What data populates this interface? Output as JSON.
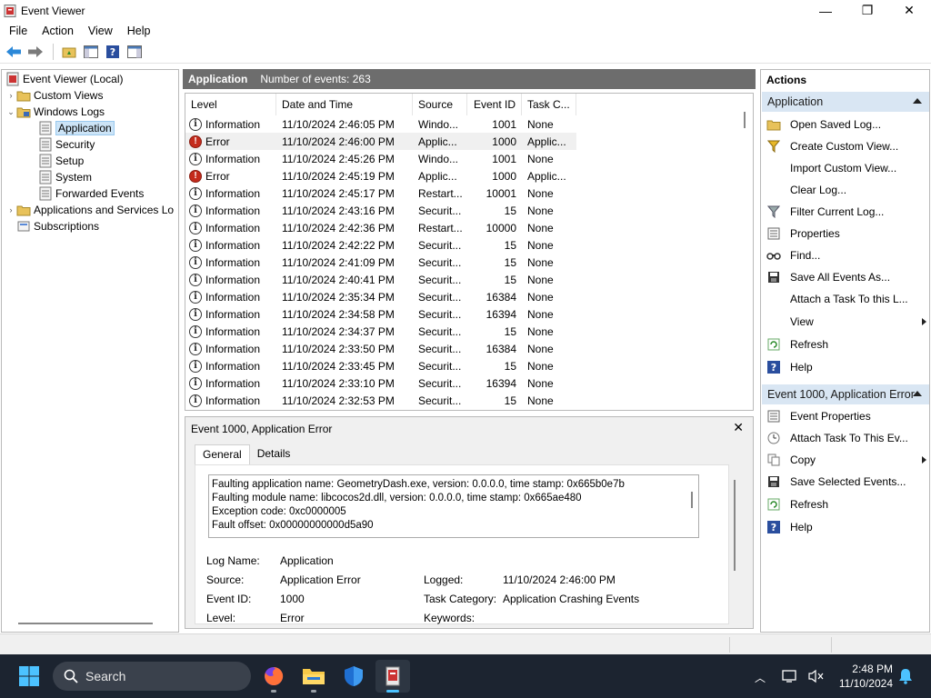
{
  "window": {
    "title": "Event Viewer",
    "min_glyph": "—",
    "max_glyph": "❐",
    "close_glyph": "✕"
  },
  "menu": [
    "File",
    "Action",
    "View",
    "Help"
  ],
  "tree": {
    "root": "Event Viewer (Local)",
    "custom_views": "Custom Views",
    "windows_logs": "Windows Logs",
    "application": "Application",
    "security": "Security",
    "setup": "Setup",
    "system": "System",
    "forwarded": "Forwarded Events",
    "apps_services": "Applications and Services Lo",
    "subscriptions": "Subscriptions"
  },
  "grid": {
    "title": "Application",
    "count_text": "Number of events: 263",
    "columns": [
      "Level",
      "Date and Time",
      "Source",
      "Event ID",
      "Task C..."
    ],
    "rows": [
      {
        "level": "Information",
        "date": "11/10/2024 2:46:05 PM",
        "source": "Windo...",
        "id": "1001",
        "task": "None"
      },
      {
        "level": "Error",
        "date": "11/10/2024 2:46:00 PM",
        "source": "Applic...",
        "id": "1000",
        "task": "Applic..."
      },
      {
        "level": "Information",
        "date": "11/10/2024 2:45:26 PM",
        "source": "Windo...",
        "id": "1001",
        "task": "None"
      },
      {
        "level": "Error",
        "date": "11/10/2024 2:45:19 PM",
        "source": "Applic...",
        "id": "1000",
        "task": "Applic..."
      },
      {
        "level": "Information",
        "date": "11/10/2024 2:45:17 PM",
        "source": "Restart...",
        "id": "10001",
        "task": "None"
      },
      {
        "level": "Information",
        "date": "11/10/2024 2:43:16 PM",
        "source": "Securit...",
        "id": "15",
        "task": "None"
      },
      {
        "level": "Information",
        "date": "11/10/2024 2:42:36 PM",
        "source": "Restart...",
        "id": "10000",
        "task": "None"
      },
      {
        "level": "Information",
        "date": "11/10/2024 2:42:22 PM",
        "source": "Securit...",
        "id": "15",
        "task": "None"
      },
      {
        "level": "Information",
        "date": "11/10/2024 2:41:09 PM",
        "source": "Securit...",
        "id": "15",
        "task": "None"
      },
      {
        "level": "Information",
        "date": "11/10/2024 2:40:41 PM",
        "source": "Securit...",
        "id": "15",
        "task": "None"
      },
      {
        "level": "Information",
        "date": "11/10/2024 2:35:34 PM",
        "source": "Securit...",
        "id": "16384",
        "task": "None"
      },
      {
        "level": "Information",
        "date": "11/10/2024 2:34:58 PM",
        "source": "Securit...",
        "id": "16394",
        "task": "None"
      },
      {
        "level": "Information",
        "date": "11/10/2024 2:34:37 PM",
        "source": "Securit...",
        "id": "15",
        "task": "None"
      },
      {
        "level": "Information",
        "date": "11/10/2024 2:33:50 PM",
        "source": "Securit...",
        "id": "16384",
        "task": "None"
      },
      {
        "level": "Information",
        "date": "11/10/2024 2:33:45 PM",
        "source": "Securit...",
        "id": "15",
        "task": "None"
      },
      {
        "level": "Information",
        "date": "11/10/2024 2:33:10 PM",
        "source": "Securit...",
        "id": "16394",
        "task": "None"
      },
      {
        "level": "Information",
        "date": "11/10/2024 2:32:53 PM",
        "source": "Securit...",
        "id": "15",
        "task": "None"
      }
    ],
    "selected_row": 1
  },
  "detail": {
    "title": "Event 1000, Application Error",
    "tab_general": "General",
    "tab_details": "Details",
    "message": [
      "Faulting application name: GeometryDash.exe, version: 0.0.0.0, time stamp: 0x665b0e7b",
      "Faulting module name: libcocos2d.dll, version: 0.0.0.0, time stamp: 0x665ae480",
      "Exception code: 0xc0000005",
      "Fault offset: 0x00000000000d5a90"
    ],
    "log_name_label": "Log Name:",
    "log_name_value": "Application",
    "source_label": "Source:",
    "source_value": "Application Error",
    "logged_label": "Logged:",
    "logged_value": "11/10/2024 2:46:00 PM",
    "event_id_label": "Event ID:",
    "event_id_value": "1000",
    "task_cat_label": "Task Category:",
    "task_cat_value": "Application Crashing Events",
    "level_label": "Level:",
    "level_value": "Error",
    "keywords_label": "Keywords:"
  },
  "actions": {
    "header": "Actions",
    "section1": "Application",
    "items1": [
      "Open Saved Log...",
      "Create Custom View...",
      "Import Custom View...",
      "Clear Log...",
      "Filter Current Log...",
      "Properties",
      "Find...",
      "Save All Events As...",
      "Attach a Task To this L...",
      "View",
      "Refresh",
      "Help"
    ],
    "section2": "Event 1000, Application Error",
    "items2": [
      "Event Properties",
      "Attach Task To This Ev...",
      "Copy",
      "Save Selected Events...",
      "Refresh",
      "Help"
    ]
  },
  "taskbar": {
    "search_placeholder": "Search",
    "time": "2:48 PM",
    "date": "11/10/2024"
  },
  "colors": {
    "accent": "#0078d4",
    "error": "#c42b1c",
    "section_bg": "#d9e6f3",
    "grid_header": "#6d6d6d"
  }
}
